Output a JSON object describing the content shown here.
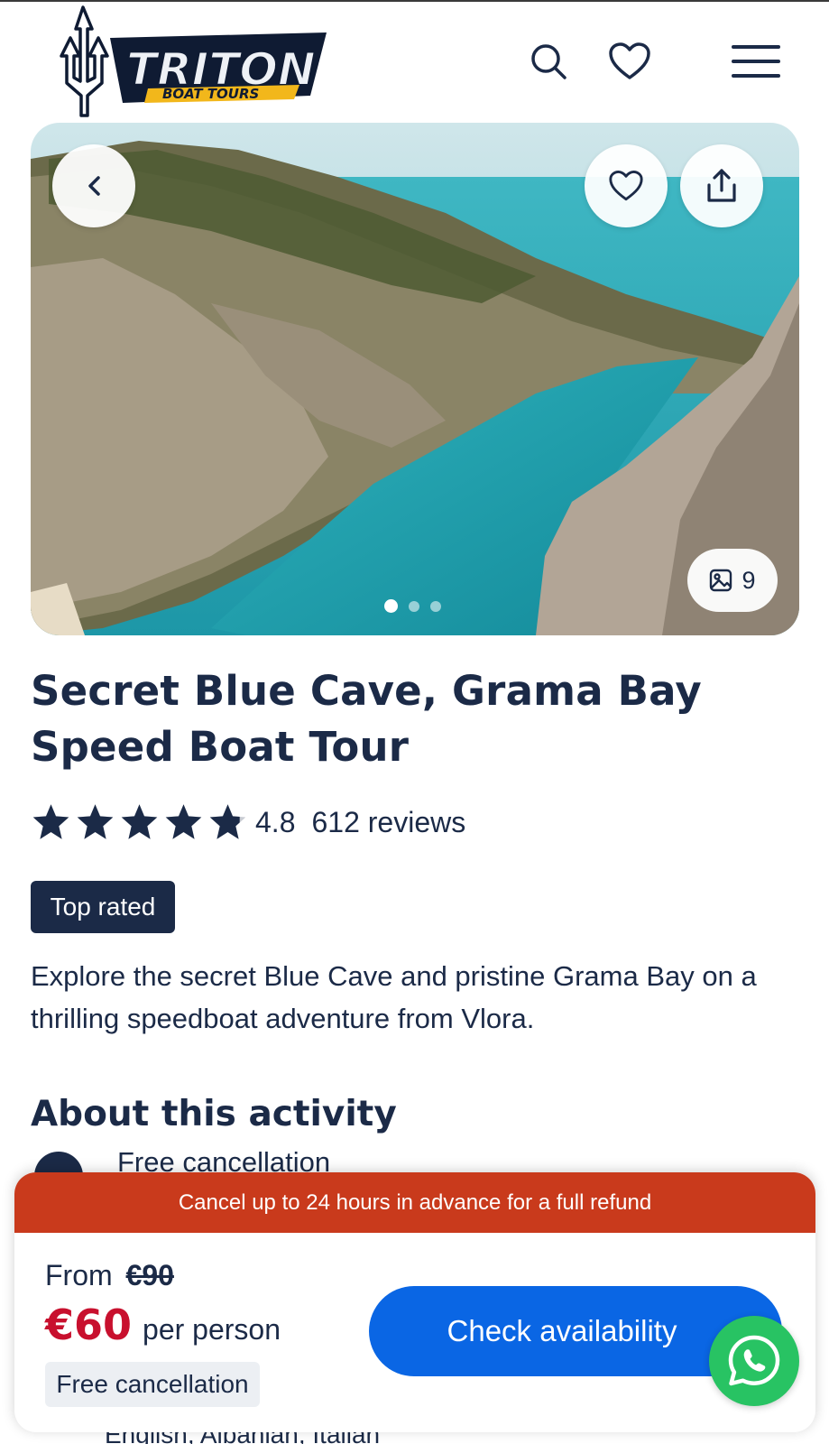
{
  "header": {
    "logo_text": "TRITON",
    "logo_subtext": "BOAT TOURS"
  },
  "hero": {
    "photo_count": "9",
    "carousel_dots": 3,
    "active_dot": 0
  },
  "tour": {
    "title": "Secret Blue Cave, Grama Bay Speed Boat Tour",
    "rating": 4.8,
    "rating_text": "4.8",
    "reviews_text": "612 reviews",
    "badge": "Top rated",
    "description": "Explore the secret Blue Cave and pristine Grama Bay on a thrilling speedboat adventure from Vlora."
  },
  "about": {
    "heading": "About this activity",
    "first_feature": "Free cancellation",
    "languages_peek": "English, Albanian, Italian"
  },
  "booking": {
    "cancel_banner": "Cancel up to 24 hours in advance for a full refund",
    "from_label": "From",
    "old_price": "€90",
    "price": "€60",
    "per_person": "per person",
    "free_cancellation": "Free cancellation",
    "cta": "Check availability"
  },
  "colors": {
    "navy": "#1b2a47",
    "cta_blue": "#0a66e4",
    "banner_red": "#c93a1c",
    "price_red": "#c8102e",
    "whatsapp_green": "#28c363"
  },
  "icons": {
    "search": "search-icon",
    "wishlist": "heart-icon",
    "menu": "hamburger-menu-icon",
    "back": "chevron-left-icon",
    "share": "share-icon",
    "gallery": "image-icon",
    "whatsapp": "whatsapp-icon"
  }
}
